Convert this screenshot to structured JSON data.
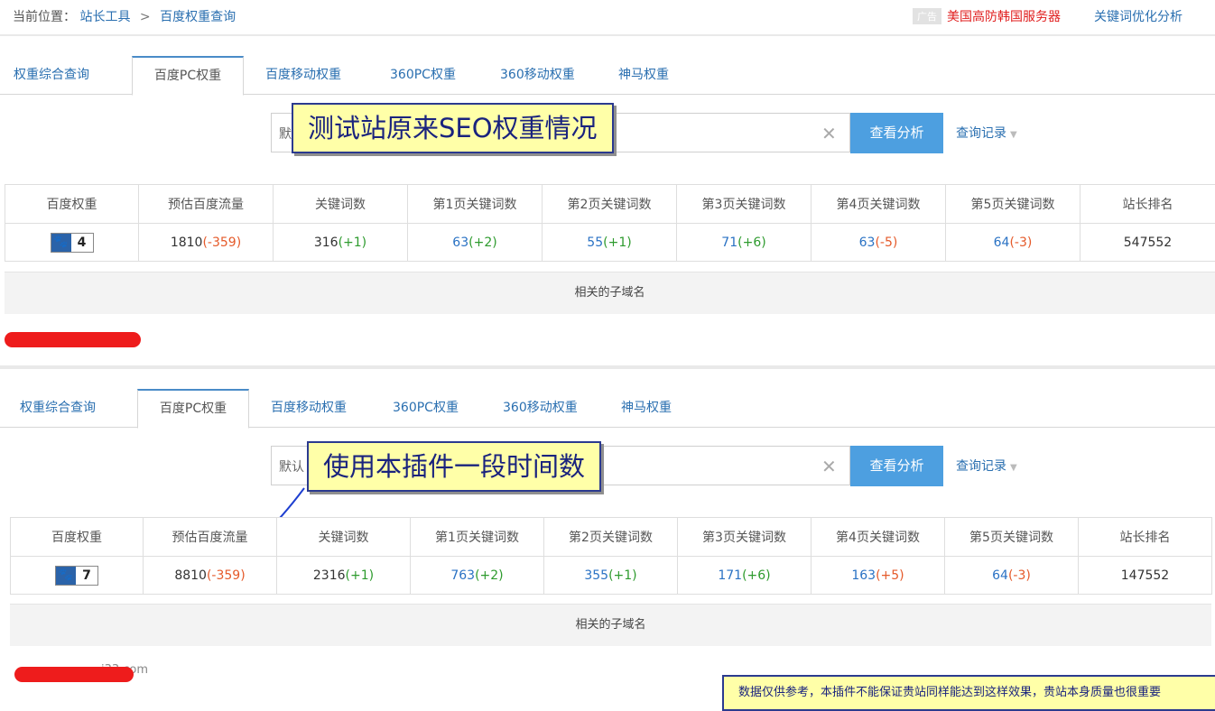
{
  "breadcrumb": {
    "prefix": "当前位置：",
    "items": [
      "站长工具",
      "百度权重查询"
    ],
    "separator": ">"
  },
  "ad": {
    "tag": "广告",
    "text": "美国高防韩国服务器"
  },
  "header_link": "关键词优化分析",
  "tabs": [
    "权重综合查询",
    "百度PC权重",
    "百度移动权重",
    "360PC权重",
    "360移动权重",
    "神马权重"
  ],
  "search": {
    "button": "查看分析",
    "history": "查询记录"
  },
  "columns": [
    "百度权重",
    "预估百度流量",
    "关键词数",
    "第1页关键词数",
    "第2页关键词数",
    "第3页关键词数",
    "第4页关键词数",
    "第5页关键词数",
    "站长排名"
  ],
  "subdomain_title": "相关的子域名",
  "panels": [
    {
      "search_prefix": "默",
      "callout": "测试站原来SEO权重情况",
      "weight": "4",
      "traffic": "1810",
      "traffic_delta": "(-359)",
      "keywords": "316",
      "keywords_delta": "(+1)",
      "p1": "63",
      "p1_delta": "(+2)",
      "p2": "55",
      "p2_delta": "(+1)",
      "p3": "71",
      "p3_delta": "(+6)",
      "p4": "63",
      "p4_delta": "(-5)",
      "p5": "64",
      "p5_delta": "(-3)",
      "rank": "547552"
    },
    {
      "search_prefix": "默认",
      "callout": "使用本插件一段时间数",
      "weight": "7",
      "traffic": "8810",
      "traffic_delta": "(-359)",
      "keywords": "2316",
      "keywords_delta": "(+1)",
      "p1": "763",
      "p1_delta": "(+2)",
      "p2": "355",
      "p2_delta": "(+1)",
      "p3": "171",
      "p3_delta": "(+6)",
      "p4": "163",
      "p4_delta": "(+5)",
      "p5": "64",
      "p5_delta": "(-3)",
      "rank": "147552",
      "subdomain_partial": "i33.com"
    }
  ],
  "disclaimer": "数据仅供参考，本插件不能保证贵站同样能达到这样效果，贵站本身质量也很重要",
  "colors": {
    "link": "#2a6fb0",
    "negative": "#e55a2a",
    "positive": "#2e9b2e",
    "button": "#4d9fe0",
    "callout_bg": "#ffffa8",
    "redaction": "#ee1c1c"
  },
  "icons": [
    "paw-icon",
    "close-icon",
    "chevron-down-icon",
    "arrow-icon"
  ]
}
